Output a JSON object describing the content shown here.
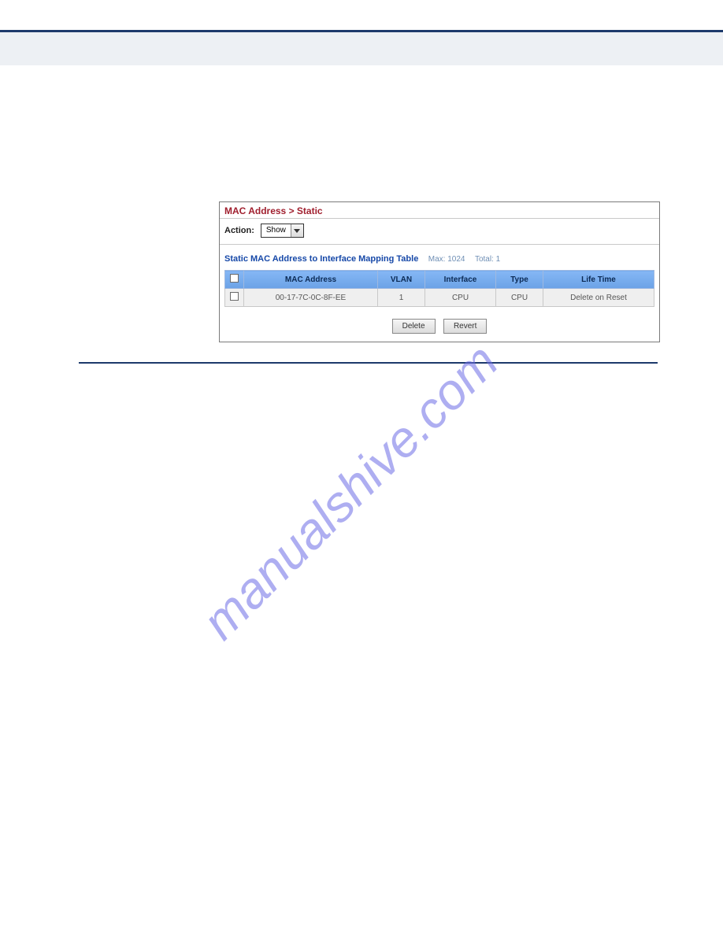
{
  "panel": {
    "title": "MAC Address > Static",
    "action_label": "Action:",
    "action_value": "Show",
    "subtitle": "Static MAC Address to Interface Mapping Table",
    "meta_max": "Max: 1024",
    "meta_total": "Total: 1",
    "columns": {
      "mac": "MAC Address",
      "vlan": "VLAN",
      "interface": "Interface",
      "type": "Type",
      "life": "Life Time"
    },
    "row": {
      "mac": "00-17-7C-0C-8F-EE",
      "vlan": "1",
      "interface": "CPU",
      "type": "CPU",
      "life": "Delete on Reset"
    },
    "buttons": {
      "delete": "Delete",
      "revert": "Revert"
    }
  },
  "watermark": "manualshive.com"
}
